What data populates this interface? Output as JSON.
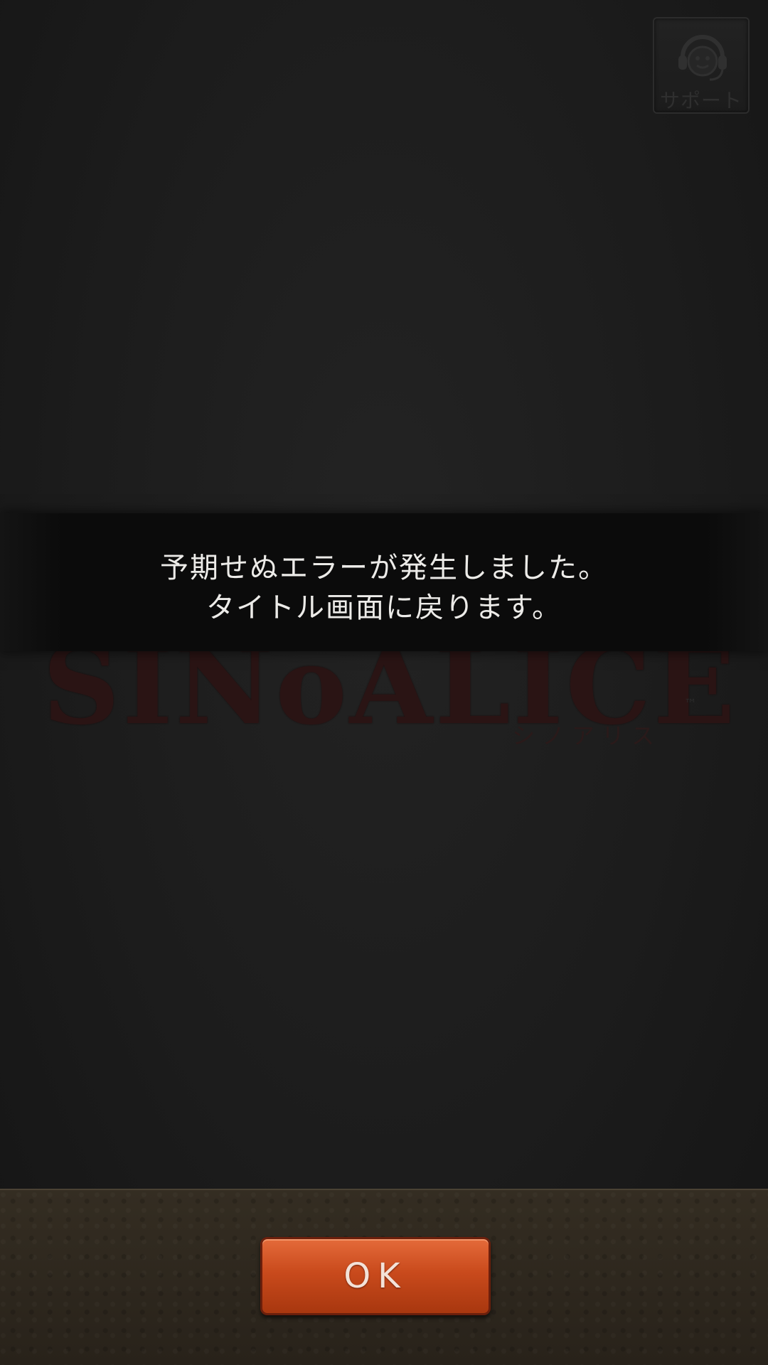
{
  "support": {
    "label": "サポート",
    "icon": "headset-face-icon"
  },
  "logo": {
    "text": "SINoALICE",
    "kana": "シノアリス",
    "trademark": "™"
  },
  "error": {
    "line1": "予期せぬエラーが発生しました。",
    "line2": "タイトル画面に戻ります。"
  },
  "footer": {
    "ok_label": "OK"
  },
  "colors": {
    "background": "#1b1b1b",
    "banner": "#0b0b0b",
    "footer": "#2c261d",
    "ok_button": "#c94a1c",
    "error_text": "#ecebe8"
  }
}
